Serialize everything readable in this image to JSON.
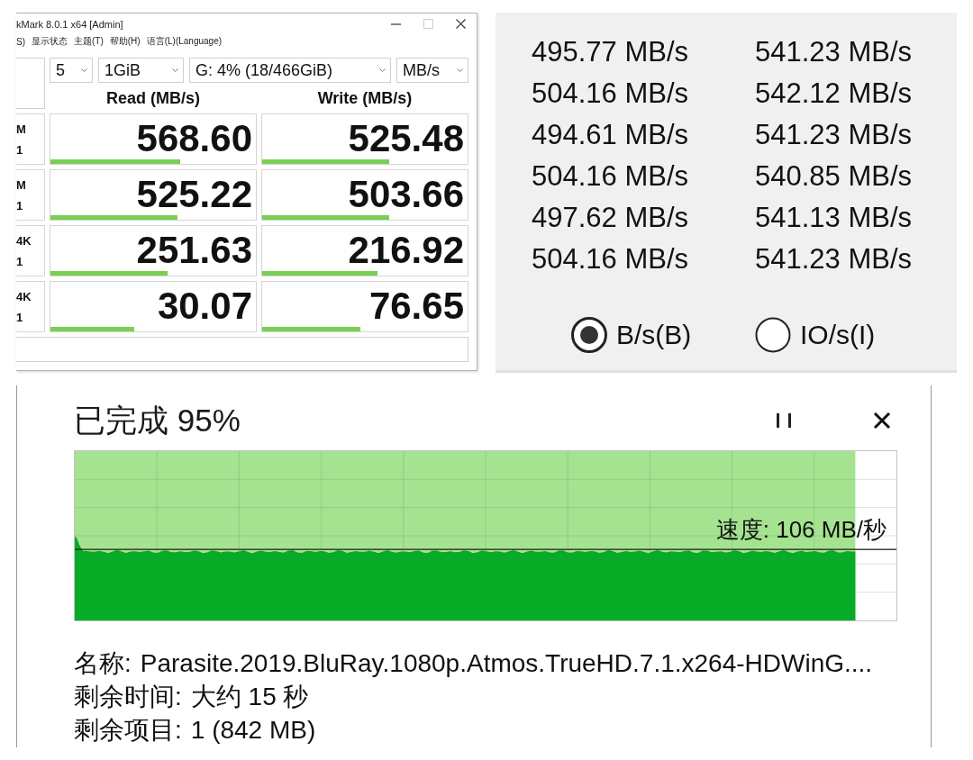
{
  "benchmark_window": {
    "title": "kMark 8.0.1 x64 [Admin]",
    "window_controls": [
      {
        "kind": "minimize",
        "disabled": false
      },
      {
        "kind": "maximize",
        "disabled": true
      },
      {
        "kind": "close",
        "disabled": false
      }
    ],
    "menu": [
      "S)",
      "显示状态",
      "主题(T)",
      "帮助(H)",
      "语言(L)(Language)"
    ],
    "selectors": [
      "5",
      "1GiB",
      "G: 4% (18/466GiB)",
      "MB/s"
    ],
    "columns": [
      "Read (MB/s)",
      "Write (MB/s)"
    ],
    "tests": [
      {
        "label": [
          "M",
          "1"
        ],
        "read": {
          "value": "568.60",
          "level": 0.63
        },
        "write": {
          "value": "525.48",
          "level": 0.62
        }
      },
      {
        "label": [
          "M",
          "1"
        ],
        "read": {
          "value": "525.22",
          "level": 0.62
        },
        "write": {
          "value": "503.66",
          "level": 0.62
        }
      },
      {
        "label": [
          "4K",
          "1"
        ],
        "read": {
          "value": "251.63",
          "level": 0.57
        },
        "write": {
          "value": "216.92",
          "level": 0.56
        }
      },
      {
        "label": [
          "4K",
          "1"
        ],
        "read": {
          "value": "30.07",
          "level": 0.41
        },
        "write": {
          "value": "76.65",
          "level": 0.48
        }
      }
    ]
  },
  "speed_list": {
    "rows": [
      {
        "column_1": "495.77 MB/s",
        "column_2": "541.23 MB/s"
      },
      {
        "column_1": "504.16 MB/s",
        "column_2": "542.12 MB/s"
      },
      {
        "column_1": "494.61 MB/s",
        "column_2": "541.23 MB/s"
      },
      {
        "column_1": "504.16 MB/s",
        "column_2": "540.85 MB/s"
      },
      {
        "column_1": "497.62 MB/s",
        "column_2": "541.13 MB/s"
      },
      {
        "column_1": "504.16 MB/s",
        "column_2": "541.23 MB/s"
      }
    ],
    "units": [
      {
        "label": "B/s(B)",
        "selected": true
      },
      {
        "label": "IO/s(I)",
        "selected": false
      }
    ]
  },
  "copy_dialog": {
    "title": "已完成 95%",
    "controls": [
      {
        "kind": "pause"
      },
      {
        "kind": "close"
      }
    ],
    "graph": {
      "level": 0.95,
      "speed": "速度: 106 MB/秒"
    },
    "details": [
      {
        "label": "名称:",
        "value": "Parasite.2019.BluRay.1080p.Atmos.TrueHD.7.1.x264-HDWinG...."
      },
      {
        "label": "剩余时间:",
        "value": "大约 15 秒"
      },
      {
        "label": "剩余项目:",
        "value": "1 (842 MB)"
      }
    ]
  }
}
